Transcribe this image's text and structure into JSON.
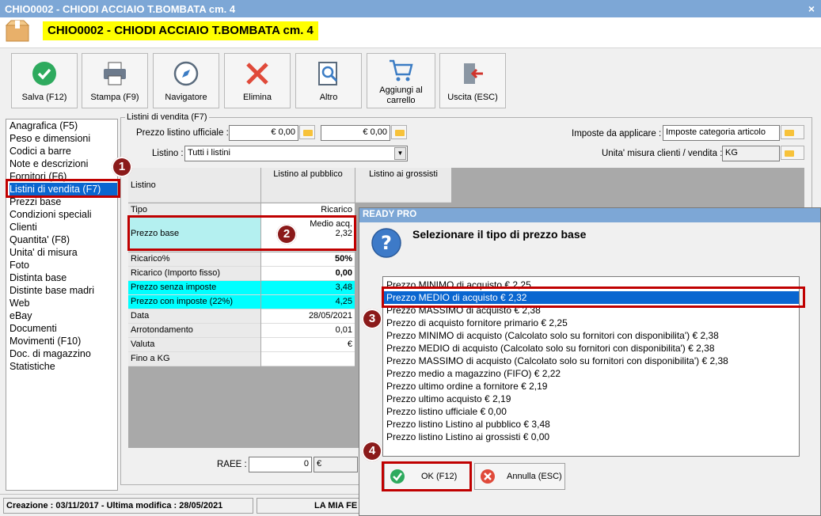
{
  "window": {
    "title": "CHIO0002 - CHIODI ACCIAIO T.BOMBATA cm. 4",
    "item_title": "CHIO0002 - CHIODI ACCIAIO T.BOMBATA cm. 4",
    "close": "×"
  },
  "toolbar": {
    "salva": "Salva (F12)",
    "stampa": "Stampa (F9)",
    "navigatore": "Navigatore",
    "elimina": "Elimina",
    "altro": "Altro",
    "aggiungi_1": "Aggiungi al",
    "aggiungi_2": "carrello",
    "uscita": "Uscita (ESC)"
  },
  "nav": {
    "items": [
      "Anagrafica (F5)",
      "Peso e dimensioni",
      "Codici a barre",
      "Note e descrizioni",
      "Fornitori (F6)",
      "Listini di vendita (F7)",
      "Prezzi base",
      "Condizioni speciali",
      "Clienti",
      "Quantita' (F8)",
      "Unita' di misura",
      "Foto",
      "Distinta base",
      "Distinte base madri",
      "Web",
      "eBay",
      "Documenti",
      "Movimenti (F10)",
      "Doc. di magazzino",
      "Statistiche"
    ],
    "selected_index": 5
  },
  "listini": {
    "group_label": "Listini di vendita (F7)",
    "prezzo_label": "Prezzo listino ufficiale :",
    "prezzo_val1": "€ 0,00",
    "prezzo_val2": "€ 0,00",
    "listino_label": "Listino :",
    "listino_value": "Tutti i listini",
    "imposte_label": "Imposte da applicare :",
    "imposte_value": "Imposte categoria articolo",
    "um_label": "Unita' misura clienti / vendita :",
    "um_value": "KG",
    "raee_label": "RAEE :",
    "raee_value": "0",
    "raee_currency": "€"
  },
  "grid": {
    "header_listino": "Listino",
    "header_pubblico": "Listino al pubblico",
    "header_grossisti": "Listino ai grossisti",
    "rows": [
      {
        "label": "Tipo",
        "value": "Ricarico"
      },
      {
        "label": "Prezzo base",
        "value": "Medio acq.",
        "value2": "2,32"
      },
      {
        "label": "Ricarico%",
        "value": "50%"
      },
      {
        "label": "Ricarico (Importo fisso)",
        "value": "0,00"
      },
      {
        "label": "Prezzo senza imposte",
        "value": "3,48"
      },
      {
        "label": "Prezzo con imposte (22%)",
        "value": "4,25"
      },
      {
        "label": "Data",
        "value": "28/05/2021"
      },
      {
        "label": "Arrotondamento",
        "value": "0,01"
      },
      {
        "label": "Valuta",
        "value": "€"
      },
      {
        "label": "Fino a KG",
        "value": ""
      }
    ]
  },
  "status": {
    "left": "Creazione : 03/11/2017 - Ultima modifica : 28/05/2021",
    "right": "LA MIA FE"
  },
  "dialog": {
    "title": "READY PRO",
    "message": "Selezionare il tipo di prezzo base",
    "options": [
      "Prezzo MINIMO di acquisto € 2,25",
      "Prezzo MEDIO di acquisto € 2,32",
      "Prezzo MASSIMO di acquisto € 2,38",
      "Prezzo di acquisto fornitore primario € 2,25",
      "Prezzo MINIMO di acquisto (Calcolato solo su fornitori con disponibilita') € 2,38",
      "Prezzo MEDIO di acquisto (Calcolato solo su fornitori con disponibilita') € 2,38",
      "Prezzo MASSIMO di acquisto (Calcolato solo su fornitori con disponibilita') € 2,38",
      "Prezzo medio a magazzino (FIFO) € 2,22",
      "Prezzo ultimo ordine a fornitore € 2,19",
      "Prezzo ultimo acquisto € 2,19",
      "Prezzo listino ufficiale € 0,00",
      "Prezzo listino Listino al pubblico € 3,48",
      "Prezzo listino Listino ai grossisti € 0,00"
    ],
    "selected_index": 1,
    "ok": "OK (F12)",
    "annulla": "Annulla (ESC)"
  },
  "badges": {
    "b1": "1",
    "b2": "2",
    "b3": "3",
    "b4": "4"
  },
  "colors": {
    "titlebar": "#7da7d6",
    "highlight": "#ffff00",
    "selection": "#0a66d0",
    "annotation": "#c00000",
    "cyan": "#00ffff",
    "lightcyan": "#b4f0f0"
  }
}
